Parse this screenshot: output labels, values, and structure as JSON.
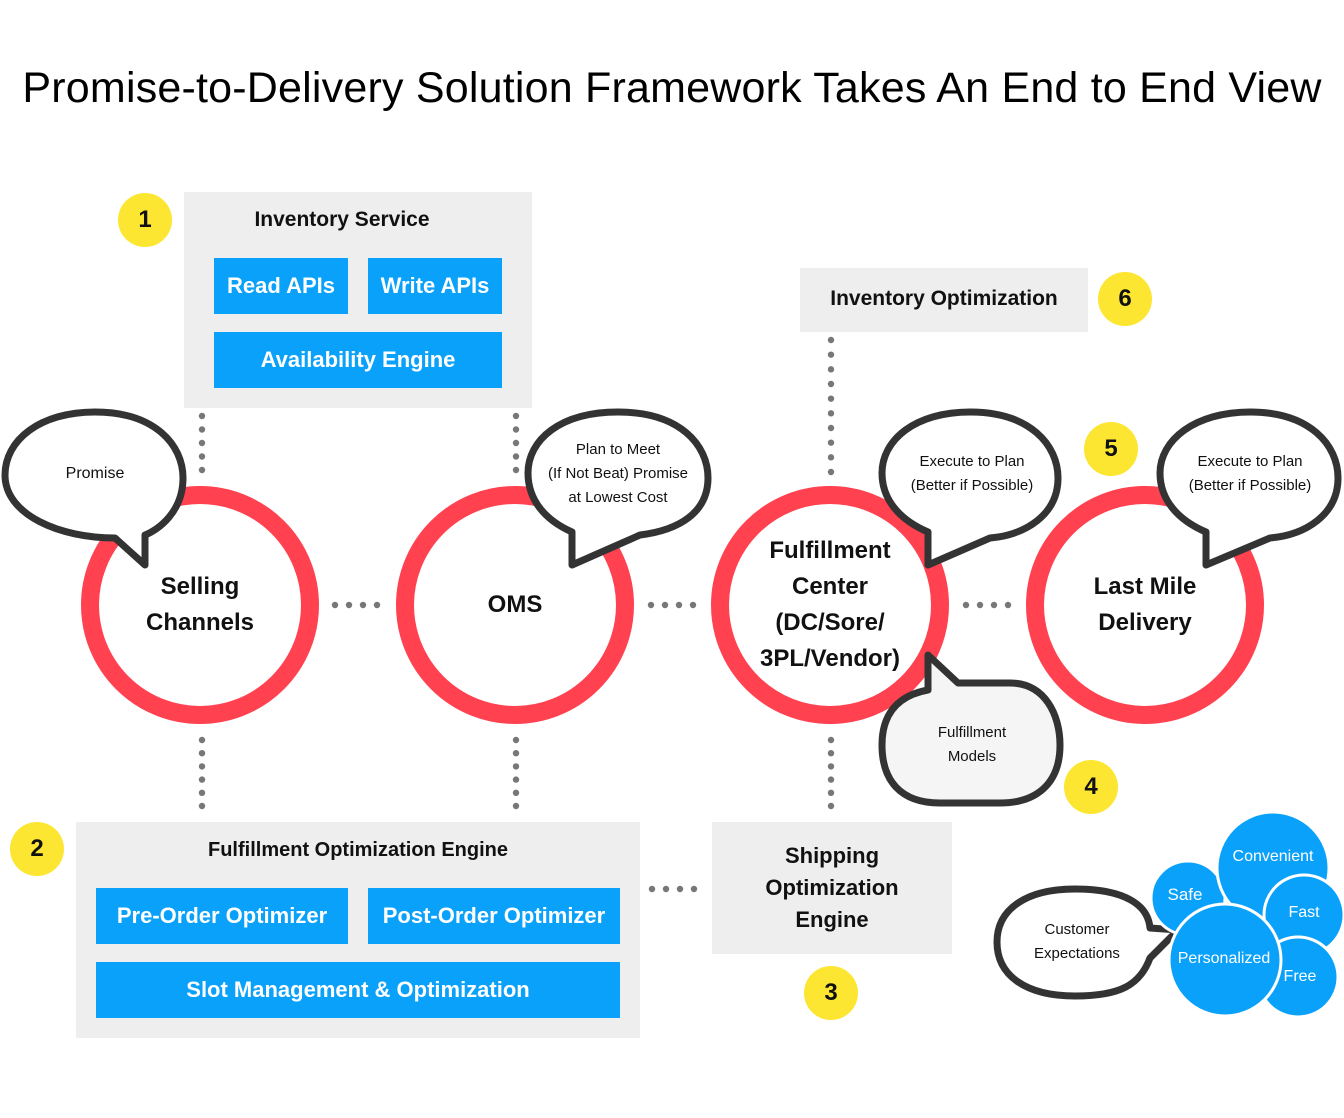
{
  "title": "Promise-to-Delivery Solution Framework Takes An End to End View",
  "colors": {
    "ring": "#ff4150",
    "blue": "#0aa1fa",
    "badge": "#fde632",
    "panel": "#eeeeee",
    "bubble_stroke": "#333333",
    "dots": "#777777"
  },
  "badges": [
    "1",
    "2",
    "3",
    "4",
    "5",
    "6"
  ],
  "inventory_service": {
    "title": "Inventory Service",
    "items": [
      "Read APIs",
      "Write APIs",
      "Availability Engine"
    ]
  },
  "inventory_optimization": {
    "title": "Inventory Optimization"
  },
  "nodes": [
    {
      "label_lines": [
        "Selling",
        "Channels"
      ]
    },
    {
      "label_lines": [
        "OMS"
      ]
    },
    {
      "label_lines": [
        "Fulfillment",
        "Center",
        "(DC/Sore/",
        "3PL/Vendor)"
      ]
    },
    {
      "label_lines": [
        "Last Mile",
        "Delivery"
      ]
    }
  ],
  "bubbles": {
    "promise": [
      "Promise"
    ],
    "oms": [
      "Plan to Meet",
      "(If Not Beat) Promise",
      "at Lowest Cost"
    ],
    "fc": [
      "Execute to Plan",
      "(Better if Possible)"
    ],
    "lastmile": [
      "Execute to Plan",
      "(Better if Possible)"
    ],
    "models": [
      "Fulfillment",
      "Models"
    ],
    "customer": [
      "Customer",
      "Expectations"
    ]
  },
  "fulfillment_engine": {
    "title": "Fulfillment Optimization Engine",
    "items": [
      "Pre-Order Optimizer",
      "Post-Order Optimizer",
      "Slot Management & Optimization"
    ]
  },
  "shipping_engine": {
    "title_lines": [
      "Shipping",
      "Optimization",
      "Engine"
    ]
  },
  "customer_expectations": [
    "Convenient",
    "Safe",
    "Fast",
    "Personalized",
    "Free"
  ]
}
